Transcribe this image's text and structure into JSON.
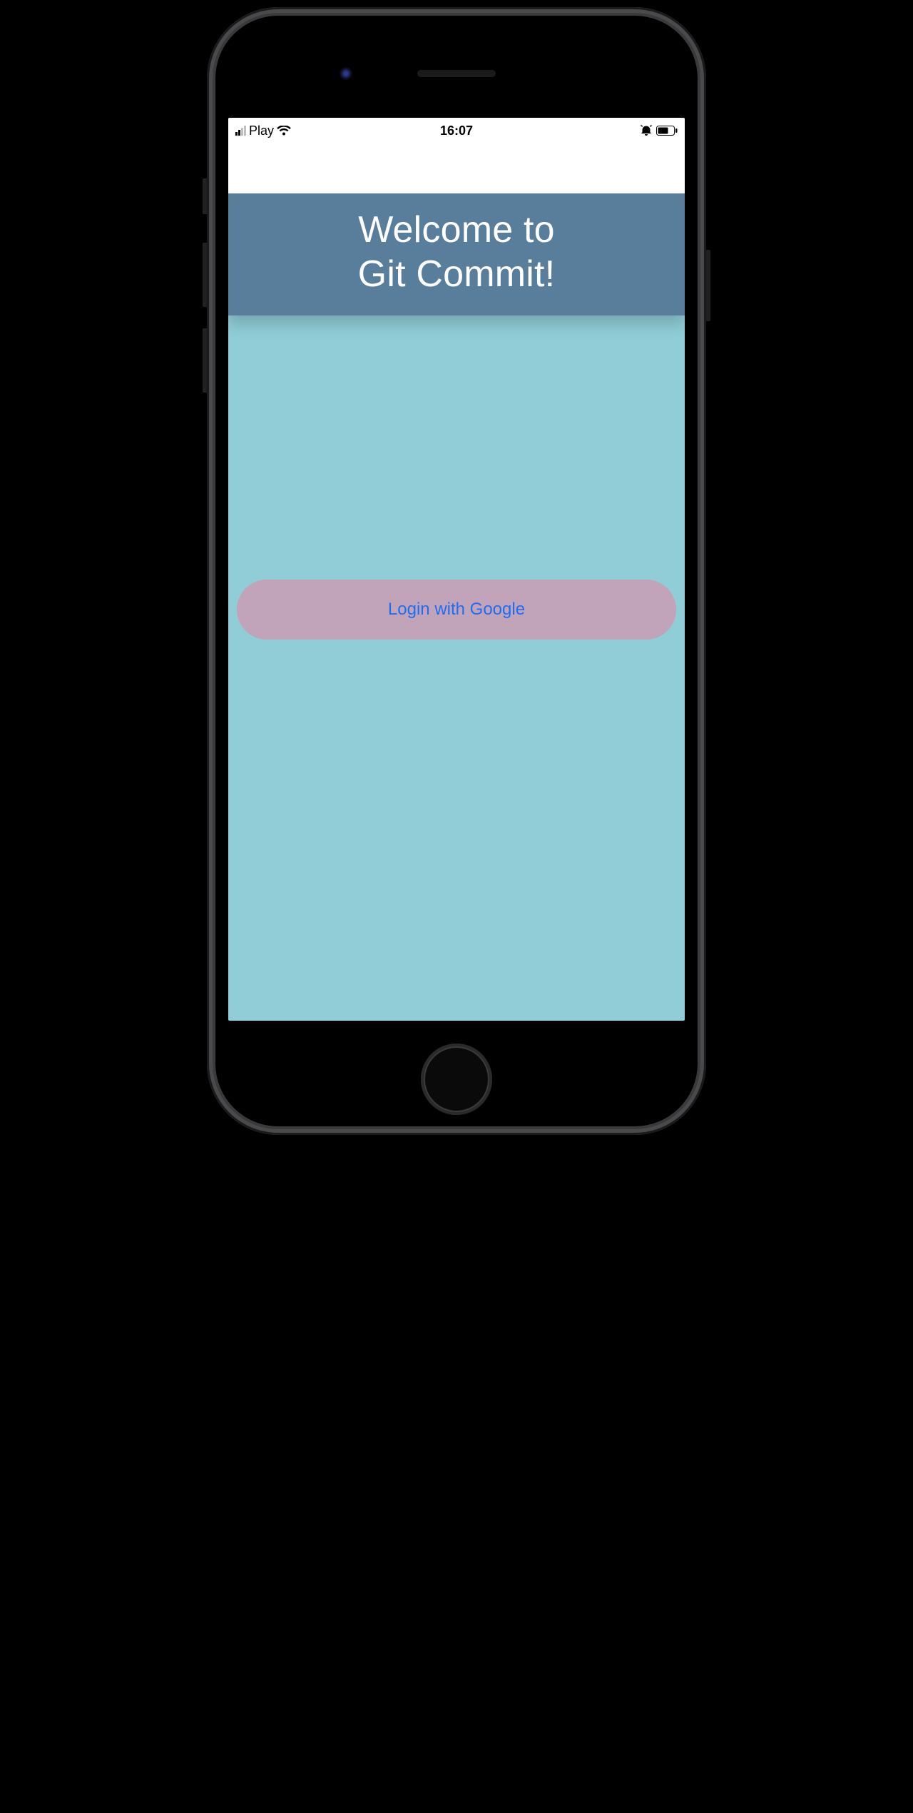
{
  "status_bar": {
    "carrier": "Play",
    "time": "16:07"
  },
  "header": {
    "title": "Welcome to\nGit Commit!"
  },
  "login": {
    "button_label": "Login with Google"
  },
  "colors": {
    "header_bg": "#587e9b",
    "content_bg": "#90cdd6",
    "button_bg": "rgba(210,150,175,0.75)",
    "button_text": "#1f6ef0"
  }
}
